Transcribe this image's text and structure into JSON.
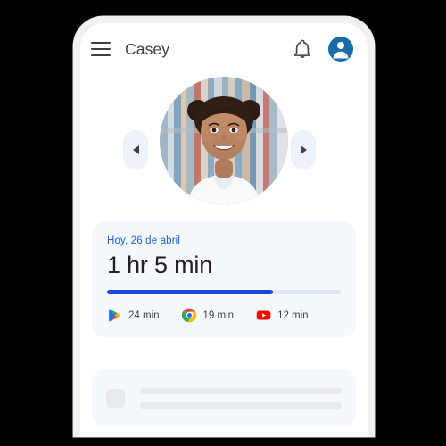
{
  "app": {
    "frame_color": "#f1f1f1",
    "screen_bg": "#ffffff",
    "backdrop": "#000000"
  },
  "appbar": {
    "menu_icon": "hamburger-menu-icon",
    "title": "Casey",
    "notification_icon": "bell-icon",
    "account_icon": "account-avatar-icon",
    "avatar_color": "#1a6ca8",
    "title_color": "#3c4043"
  },
  "carousel": {
    "prev_label": "◀",
    "next_label": "▶",
    "prev_icon": "chevron-left-icon",
    "next_icon": "chevron-right-icon",
    "button_bg": "#eef2f9",
    "photo_alt": "Child profile photo in front of bookshelves"
  },
  "screen_time_card": {
    "date_label": "Hoy, 26 de abril",
    "date_color": "#1b63e8",
    "total_label": "1 hr 5 min",
    "total_color": "#202124",
    "card_bg": "#f5f8fc",
    "progress": {
      "percent": 71,
      "fill_color": "#1b48d8",
      "track_color": "#dde7fa"
    },
    "apps": [
      {
        "name": "Google Play Store",
        "icon": "google-play-icon",
        "time": "24 min"
      },
      {
        "name": "Google Chrome",
        "icon": "chrome-icon",
        "time": "19 min"
      },
      {
        "name": "YouTube",
        "icon": "youtube-icon",
        "time": "12 min"
      }
    ]
  },
  "placeholder_card": {
    "card_bg": "#f5f8fc",
    "thumb_color": "#e8eaed",
    "line_color": "#e8eaed",
    "line_count": 2
  }
}
